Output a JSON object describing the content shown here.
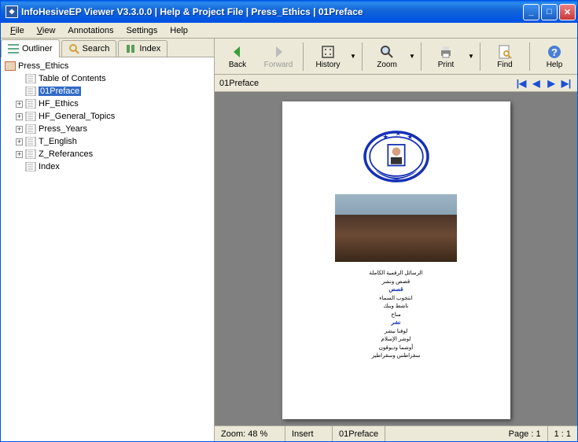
{
  "titlebar": {
    "app": "InfoHesiveEP Viewer V3.3.0.0",
    "sep1": " | ",
    "help": "Help & Project File",
    "sep2": " | ",
    "proj": "Press_Ethics",
    "sep3": " | ",
    "doc": "01Preface"
  },
  "menu": {
    "file": "File",
    "view": "View",
    "annotations": "Annotations",
    "settings": "Settings",
    "help": "Help"
  },
  "tabs": {
    "outliner": "Outliner",
    "search": "Search",
    "index": "Index"
  },
  "tree": {
    "root": "Press_Ethics",
    "items": [
      {
        "label": "Table of Contents",
        "expand": false
      },
      {
        "label": "01Preface",
        "expand": false,
        "selected": true
      },
      {
        "label": "HF_Ethics",
        "expand": true
      },
      {
        "label": "HF_General_Topics",
        "expand": true
      },
      {
        "label": "Press_Years",
        "expand": true
      },
      {
        "label": "T_English",
        "expand": true
      },
      {
        "label": "Z_Referances",
        "expand": true
      },
      {
        "label": "Index",
        "expand": false
      }
    ]
  },
  "toolbar": {
    "back": "Back",
    "forward": "Forward",
    "history": "History",
    "zoom": "Zoom",
    "print": "Print",
    "find": "Find",
    "help": "Help"
  },
  "crumb": "01Preface",
  "page_text": {
    "l1": "الرسائل الرقمية الكاملة",
    "l2": "قصص ونشر",
    "l3": "قصص",
    "l4": "انتجوب السماء",
    "l5": "ناشط وينك",
    "l6": "مناخ",
    "l7": "نشر",
    "l8": "لوفنا نيشر",
    "l9": "لوشر الإسلام",
    "l10": "أوشما وديوقون",
    "l11": "سقراطس وسقراطيز"
  },
  "status": {
    "zoom": "Zoom: 48 %",
    "mode": "Insert",
    "doc": "01Preface",
    "page": "Page : 1",
    "ratio": "1 : 1"
  }
}
